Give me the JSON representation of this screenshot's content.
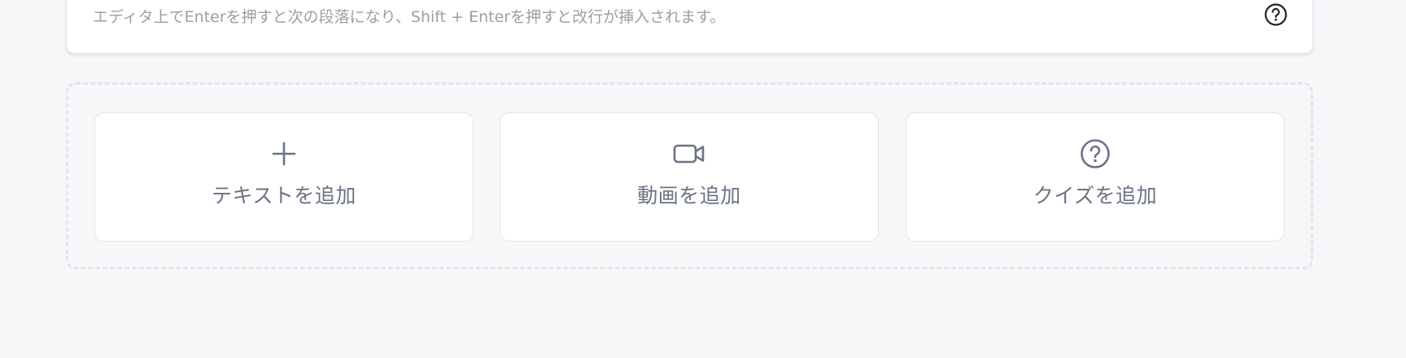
{
  "editor": {
    "hint_text": "エディタ上でEnterを押すと次の段落になり、Shift + Enterを押すと改行が挿入されます。",
    "help_icon": "question-circle-icon"
  },
  "add_buttons": [
    {
      "label": "テキストを追加",
      "icon": "plus-icon"
    },
    {
      "label": "動画を追加",
      "icon": "video-camera-icon"
    },
    {
      "label": "クイズを追加",
      "icon": "question-circle-icon"
    }
  ],
  "colors": {
    "background": "#f6f7f9",
    "card": "#ffffff",
    "hint_text": "#9a9fa8",
    "button_text": "#6b7385",
    "dashed_border": "#e1e5eb"
  }
}
